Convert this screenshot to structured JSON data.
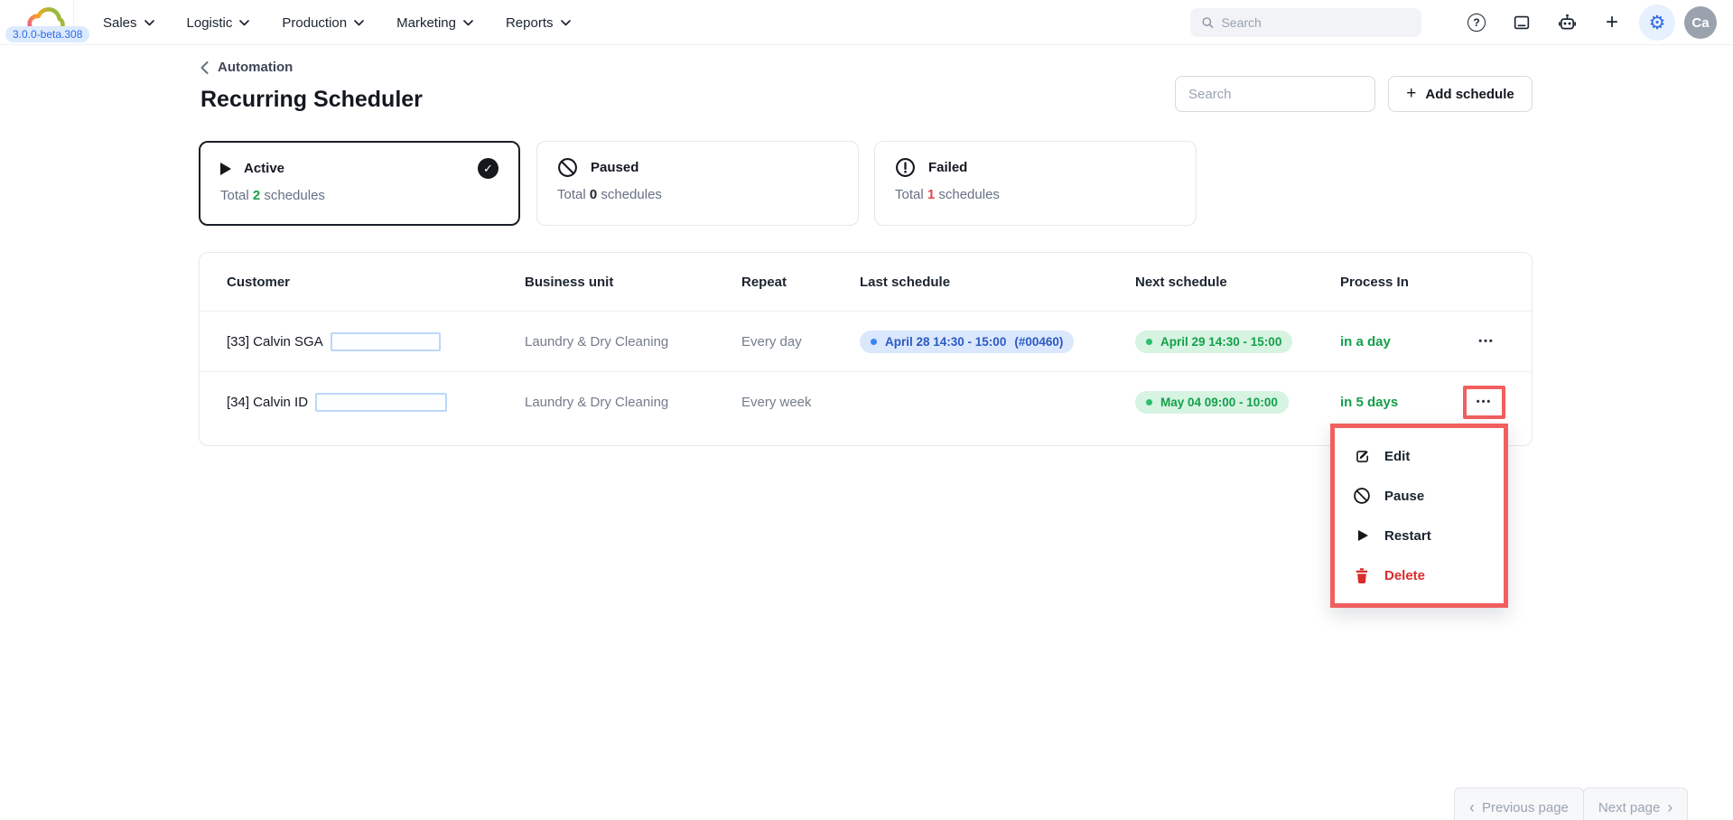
{
  "topbar": {
    "version": "3.0.0-beta.308",
    "nav_items": [
      {
        "label": "Sales"
      },
      {
        "label": "Logistic"
      },
      {
        "label": "Production"
      },
      {
        "label": "Marketing"
      },
      {
        "label": "Reports"
      }
    ],
    "search_placeholder": "Search",
    "avatar_initials": "Ca"
  },
  "header": {
    "breadcrumb": "Automation",
    "title": "Recurring Scheduler",
    "search_placeholder": "Search",
    "add_schedule_label": "Add schedule",
    "add_schedule_plus": "+"
  },
  "status_cards": [
    {
      "label": "Active",
      "total_prefix": "Total",
      "count": "2",
      "total_suffix": "schedules",
      "selected": true
    },
    {
      "label": "Paused",
      "total_prefix": "Total",
      "count": "0",
      "total_suffix": "schedules",
      "selected": false
    },
    {
      "label": "Failed",
      "total_prefix": "Total",
      "count": "1",
      "total_suffix": "schedules",
      "selected": false
    }
  ],
  "table": {
    "columns": [
      "Customer",
      "Business unit",
      "Repeat",
      "Last schedule",
      "Next schedule",
      "Process In"
    ],
    "rows": [
      {
        "customer": "[33] Calvin SGA",
        "business_unit": "Laundry & Dry Cleaning",
        "repeat": "Every day",
        "last_schedule": "April 28 14:30 - 15:00",
        "last_schedule_ref": "(#00460)",
        "next_schedule": "April 29 14:30 - 15:00",
        "process_in": "in a day"
      },
      {
        "customer": "[34] Calvin ID",
        "business_unit": "Laundry & Dry Cleaning",
        "repeat": "Every week",
        "last_schedule": "",
        "last_schedule_ref": "",
        "next_schedule": "May 04 09:00 - 10:00",
        "process_in": "in 5 days"
      }
    ],
    "ellipsis_glyph": "•••"
  },
  "context_menu": {
    "items": [
      {
        "label": "Edit"
      },
      {
        "label": "Pause"
      },
      {
        "label": "Restart"
      },
      {
        "label": "Delete"
      }
    ]
  },
  "pagination": {
    "previous_label": "Previous page",
    "next_label": "Next page",
    "prev_chevron": "‹",
    "next_chevron": "›"
  },
  "colors": {
    "accent_blue": "#2e6be6",
    "green": "#13a04a",
    "red": "#e5484d",
    "annotation_red": "#f15f5f",
    "pill_blue_bg": "#dbe7fd",
    "pill_green_bg": "#d7f3e2"
  }
}
